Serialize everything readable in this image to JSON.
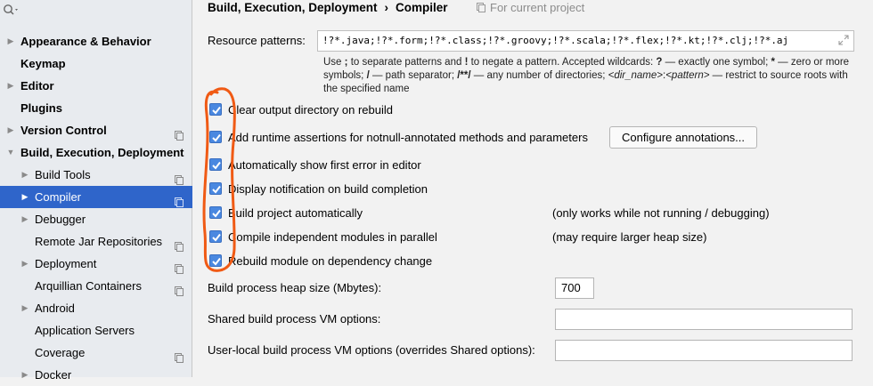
{
  "sidebar": {
    "search": {
      "placeholder": ""
    },
    "items": [
      {
        "label": "Appearance & Behavior",
        "arrow": "▶"
      },
      {
        "label": "Keymap"
      },
      {
        "label": "Editor",
        "arrow": "▶"
      },
      {
        "label": "Plugins"
      },
      {
        "label": "Version Control",
        "arrow": "▶"
      },
      {
        "label": "Build, Execution, Deployment",
        "arrow": "▼"
      },
      {
        "label": "Build Tools",
        "arrow": "▶"
      },
      {
        "label": "Compiler",
        "arrow": "▶"
      },
      {
        "label": "Debugger",
        "arrow": "▶"
      },
      {
        "label": "Remote Jar Repositories"
      },
      {
        "label": "Deployment",
        "arrow": "▶"
      },
      {
        "label": "Arquillian Containers"
      },
      {
        "label": "Android",
        "arrow": "▶"
      },
      {
        "label": "Application Servers"
      },
      {
        "label": "Coverage"
      },
      {
        "label": "Docker",
        "arrow": "▶"
      }
    ]
  },
  "header": {
    "breadcrumb_parent": "Build, Execution, Deployment",
    "breadcrumb_separator": "›",
    "breadcrumb_current": "Compiler",
    "scope_note": "For current project"
  },
  "resource": {
    "label": "Resource patterns:",
    "value": "!?*.java;!?*.form;!?*.class;!?*.groovy;!?*.scala;!?*.flex;!?*.kt;!?*.clj;!?*.aj",
    "help": {
      "t1": "Use ",
      "b1": ";",
      "t2": " to separate patterns and ",
      "b2": "!",
      "t3": " to negate a pattern. Accepted wildcards: ",
      "b3": "?",
      "t4": " — exactly one symbol; ",
      "b4": "*",
      "t5": " — zero or more symbols; ",
      "b5": "/",
      "t6": " — path separator; ",
      "b6": "/**/",
      "t7": " — any number of directories; ",
      "i1": "<dir_name>",
      "t8": ":",
      "i2": "<pattern>",
      "t9": " — restrict to source roots with the specified name"
    }
  },
  "options": {
    "clear_output": {
      "label": "Clear output directory on rebuild",
      "checked": true
    },
    "runtime_assertions": {
      "label": "Add runtime assertions for notnull-annotated methods and parameters",
      "checked": true
    },
    "configure_button": "Configure annotations...",
    "show_first_error": {
      "label": "Automatically show first error in editor",
      "checked": true
    },
    "display_notification": {
      "label": "Display notification on build completion",
      "checked": true
    },
    "build_automatically": {
      "label": "Build project automatically",
      "checked": true,
      "note": "(only works while not running / debugging)"
    },
    "compile_parallel": {
      "label": "Compile independent modules in parallel",
      "checked": true,
      "note": "(may require larger heap size)"
    },
    "rebuild_on_change": {
      "label": "Rebuild module on dependency change",
      "checked": true
    }
  },
  "heap": {
    "label": "Build process heap size (Mbytes):",
    "value": "700"
  },
  "shared_vm": {
    "label": "Shared build process VM options:",
    "value": ""
  },
  "user_vm": {
    "label": "User-local build process VM options (overrides Shared options):",
    "value": ""
  },
  "colors": {
    "selection": "#2f65ca",
    "checkbox": "#4a88e0",
    "annotation": "#f05a14",
    "sidebar_bg": "#e8ebef",
    "panel_bg": "#f2f2f2"
  },
  "icons": {
    "search": "search-icon",
    "copy": "project-scope-icon",
    "expand": "expand-icon",
    "check": "check-icon"
  }
}
